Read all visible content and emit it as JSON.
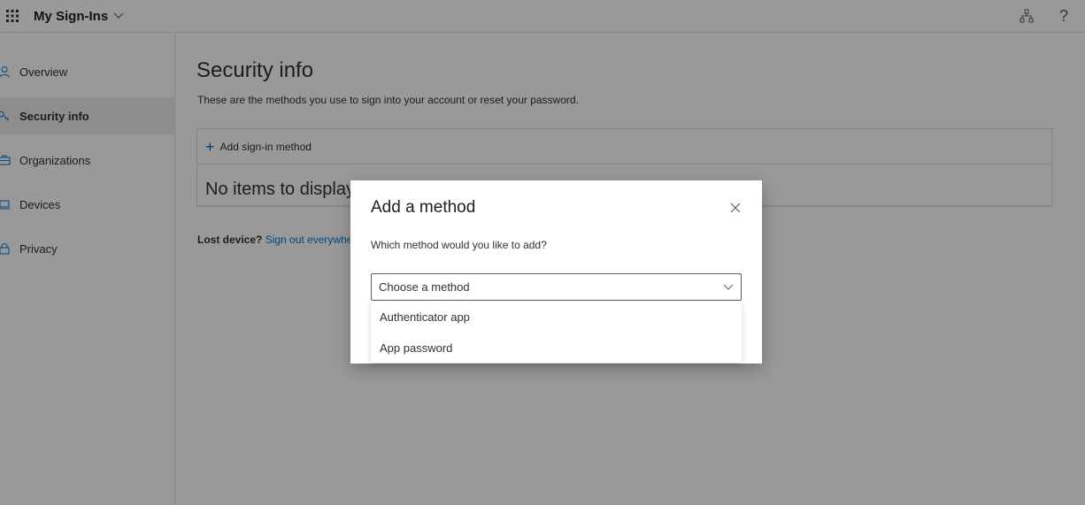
{
  "header": {
    "app_title": "My Sign-Ins",
    "help_glyph": "?"
  },
  "sidebar": {
    "items": [
      {
        "label": "Overview",
        "icon": "person-icon"
      },
      {
        "label": "Security info",
        "icon": "key-icon",
        "active": true
      },
      {
        "label": "Organizations",
        "icon": "briefcase-icon"
      },
      {
        "label": "Devices",
        "icon": "laptop-icon"
      },
      {
        "label": "Privacy",
        "icon": "lock-icon"
      }
    ]
  },
  "main": {
    "title": "Security info",
    "description": "These are the methods you use to sign into your account or reset your password.",
    "add_method_label": "Add sign-in method",
    "no_items": "No items to display.",
    "lost_device_label": "Lost device?",
    "sign_out_link": "Sign out everywhere"
  },
  "dialog": {
    "title": "Add a method",
    "question": "Which method would you like to add?",
    "select_placeholder": "Choose a method",
    "options": [
      "Authenticator app",
      "App password"
    ]
  },
  "colors": {
    "accent": "#0078d4",
    "active_nav": "#edebe9",
    "overlay": "rgba(0,0,0,0.40)"
  }
}
